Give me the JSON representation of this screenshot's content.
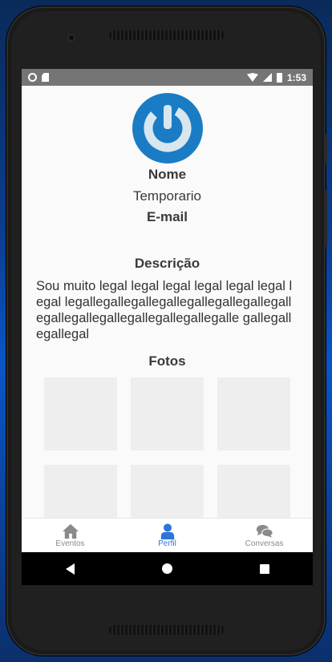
{
  "statusbar": {
    "time": "1:53"
  },
  "profile": {
    "name_label": "Nome",
    "name_value": "Temporario",
    "email_label": "E-mail",
    "description_label": "Descrição",
    "description_text": "Sou muito legal legal legal legal legal legal legal legallegallegallegallegallegallegallegallegallegallegallegallegallegallegalle gallegallegallegal",
    "photos_label": "Fotos",
    "photo_count": 6
  },
  "tabs": [
    {
      "label": "Eventos",
      "icon": "home-icon",
      "active": false
    },
    {
      "label": "Perfil",
      "icon": "user-icon",
      "active": true
    },
    {
      "label": "Conversas",
      "icon": "chat-icon",
      "active": false
    }
  ],
  "colors": {
    "accent": "#2f74d8",
    "avatar_blue": "#1a7cc4"
  }
}
